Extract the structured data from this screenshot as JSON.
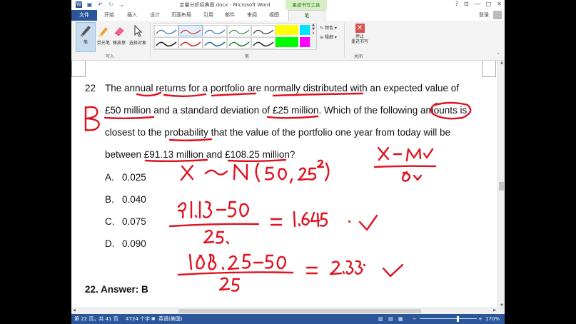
{
  "titlebar": {
    "title": "定量分析经典题.docx - Microsoft Word",
    "context_tab": "墨迹书写工具",
    "help": "?",
    "minimize": "—",
    "restore": "□",
    "close": "✕"
  },
  "tabs": [
    {
      "label": "文件"
    },
    {
      "label": "开始"
    },
    {
      "label": "插入"
    },
    {
      "label": "设计"
    },
    {
      "label": "页面布局"
    },
    {
      "label": "引用"
    },
    {
      "label": "邮件"
    },
    {
      "label": "审阅"
    },
    {
      "label": "视图"
    },
    {
      "label": "笔"
    }
  ],
  "account": {
    "login_label": "登录"
  },
  "ribbon": {
    "pen_label": "笔",
    "highlighter_label": "荧光笔",
    "eraser_label": "橡皮擦",
    "select_label": "选择对象",
    "group_write": "写入",
    "group_pens": "笔",
    "color_label": "颜色",
    "thickness_label": "粗细",
    "stop_line1": "停止",
    "stop_line2": "墨迹书写",
    "group_close": "关闭",
    "pen_colors": [
      "#2f6f9f",
      "#c0392b",
      "#2f6f9f",
      "#2e8b3a",
      "#333333",
      "#ffff00",
      "#00e5ff",
      "#222222",
      "#c0392b",
      "#2f6f9f",
      "#2e8b3a",
      "#333333",
      "#00ff00",
      "#ff00ff"
    ]
  },
  "document": {
    "question_number": "22",
    "lines": [
      "The annual returns for a portfolio are normally distributed with an expected value of",
      "£50 million and a standard deviation of £25 million. Which of the following amounts is",
      "closest to the probability that the value of the portfolio one year from today will be",
      "between £91.13 million and £108.25 million?"
    ],
    "options": [
      {
        "letter": "A.",
        "value": "0.025"
      },
      {
        "letter": "B.",
        "value": "0.040"
      },
      {
        "letter": "C.",
        "value": "0.075"
      },
      {
        "letter": "D.",
        "value": "0.090"
      }
    ],
    "answer": "22.  Answer: B"
  },
  "ink_color": "#e0121f",
  "statusbar": {
    "page": "第 22 页，共 41 页",
    "words": "4724 个字",
    "language": "英语(美国)",
    "zoom": "170%"
  }
}
